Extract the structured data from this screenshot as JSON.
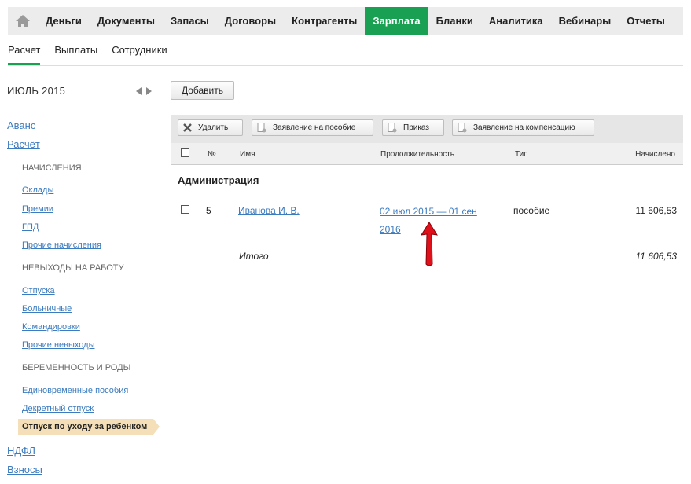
{
  "nav": {
    "items": [
      "Деньги",
      "Документы",
      "Запасы",
      "Договоры",
      "Контрагенты",
      "Зарплата",
      "Бланки",
      "Аналитика",
      "Вебинары",
      "Отчеты"
    ],
    "active": "Зарплата",
    "home_icon": "home-icon",
    "accent": "#1aa053"
  },
  "subnav": {
    "items": [
      "Расчет",
      "Выплаты",
      "Сотрудники"
    ],
    "active": "Расчет"
  },
  "sidebar": {
    "period": "ИЮЛЬ 2015",
    "avans": "Аванс",
    "raschet": "Расчёт",
    "accruals_head": "НАЧИСЛЕНИЯ",
    "accruals": [
      "Оклады",
      "Премии",
      "ГПД",
      "Прочие начисления"
    ],
    "absences_head": "НЕВЫХОДЫ НА РАБОТУ",
    "absences": [
      "Отпуска",
      "Больничные",
      "Командировки",
      "Прочие невыходы"
    ],
    "pregnancy_head": "БЕРЕМЕННОСТЬ И РОДЫ",
    "pregnancy": [
      "Единовременные пособия",
      "Декретный отпуск"
    ],
    "active_item": "Отпуск по уходу за ребенком",
    "ndfl": "НДФЛ",
    "vznosy": "Взносы"
  },
  "main": {
    "add_button": "Добавить",
    "toolbar": {
      "delete": "Удалить",
      "benefit_application": "Заявление на пособие",
      "order": "Приказ",
      "compensation_application": "Заявление на компенсацию"
    },
    "table": {
      "headers": {
        "number": "№",
        "name": "Имя",
        "duration": "Продолжительность",
        "type": "Тип",
        "accrued": "Начислено"
      },
      "group": "Администрация",
      "rows": [
        {
          "number": "5",
          "name": "Иванова И. В.",
          "duration": "02 июл 2015 — 01 сен 2016",
          "type": "пособие",
          "accrued": "11 606,53"
        }
      ],
      "total_label": "Итого",
      "total_value": "11 606,53"
    }
  }
}
